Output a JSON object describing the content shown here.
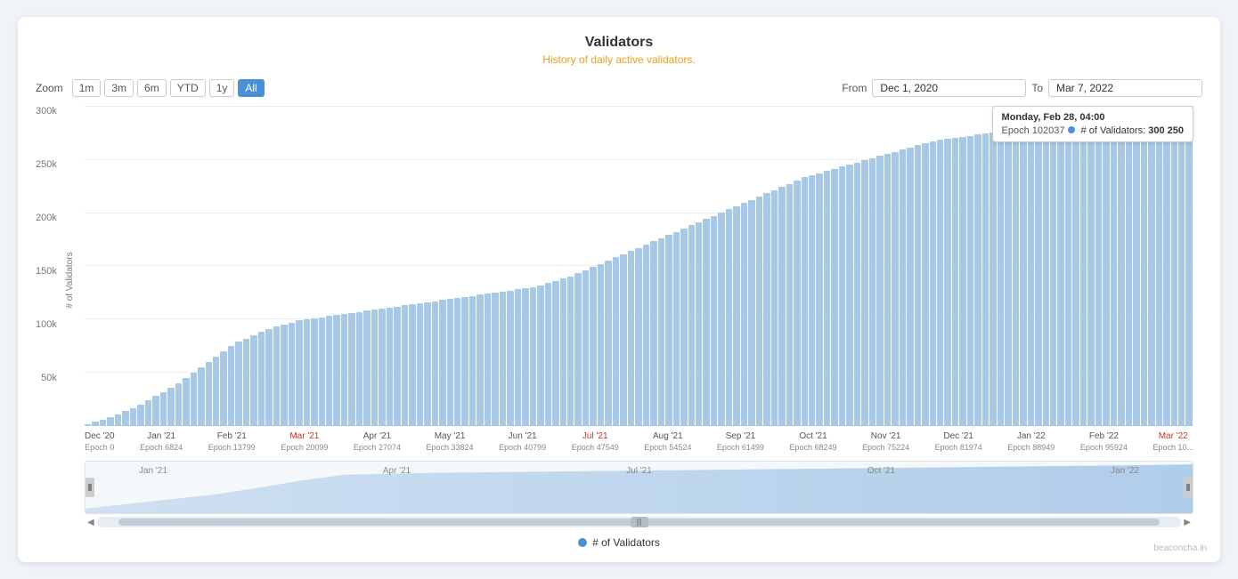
{
  "title": "Validators",
  "subtitle": "History of daily active validators.",
  "zoom": {
    "label": "Zoom",
    "options": [
      "1m",
      "3m",
      "6m",
      "YTD",
      "1y",
      "All"
    ],
    "active": "All"
  },
  "dateRange": {
    "from_label": "From",
    "from_value": "Dec 1, 2020",
    "to_label": "To",
    "to_value": "Mar 7, 2022"
  },
  "tooltip": {
    "date": "Monday, Feb 28, 04:00",
    "epoch_label": "Epoch 102037",
    "validators_label": "# of Validators:",
    "validators_value": "300 250"
  },
  "yAxis": {
    "title": "# of Validators",
    "labels": [
      "300k",
      "250k",
      "200k",
      "150k",
      "100k",
      "50k",
      ""
    ]
  },
  "xAxis": {
    "labels": [
      {
        "date": "Dec '20",
        "epoch": "Epoch 0",
        "red": false
      },
      {
        "date": "Jan '21",
        "epoch": "Epoch 6824",
        "red": false
      },
      {
        "date": "Feb '21",
        "epoch": "Epoch 13799",
        "red": false
      },
      {
        "date": "Mar '21",
        "epoch": "Epoch 20099",
        "red": true
      },
      {
        "date": "Apr '21",
        "epoch": "Epoch 27074",
        "red": false
      },
      {
        "date": "May '21",
        "epoch": "Epoch 33824",
        "red": false
      },
      {
        "date": "Jun '21",
        "epoch": "Epoch 40799",
        "red": false
      },
      {
        "date": "Jul '21",
        "epoch": "Epoch 47549",
        "red": true
      },
      {
        "date": "Aug '21",
        "epoch": "Epoch 54524",
        "red": false
      },
      {
        "date": "Sep '21",
        "epoch": "Epoch 61499",
        "red": false
      },
      {
        "date": "Oct '21",
        "epoch": "Epoch 68249",
        "red": false
      },
      {
        "date": "Nov '21",
        "epoch": "Epoch 75224",
        "red": false
      },
      {
        "date": "Dec '21",
        "epoch": "Epoch 81974",
        "red": false
      },
      {
        "date": "Jan '22",
        "epoch": "Epoch 88949",
        "red": false
      },
      {
        "date": "Feb '22",
        "epoch": "Epoch 95924",
        "red": false
      },
      {
        "date": "Mar '22",
        "epoch": "Epoch 10...",
        "red": true
      }
    ]
  },
  "navigator": {
    "labels": [
      "Jan '21",
      "Apr '21",
      "Jul '21",
      "Oct '21",
      "Jan '22"
    ]
  },
  "legend": {
    "label": "# of Validators"
  },
  "watermark": "beaconcha.in",
  "bars": [
    2,
    4,
    6,
    8,
    11,
    14,
    17,
    20,
    24,
    28,
    32,
    36,
    40,
    45,
    50,
    55,
    60,
    65,
    70,
    75,
    79,
    82,
    85,
    88,
    91,
    93,
    95,
    97,
    99,
    100,
    101,
    102,
    103,
    104,
    105,
    106,
    107,
    108,
    109,
    110,
    111,
    112,
    113,
    114,
    115,
    116,
    117,
    118,
    119,
    120,
    121,
    122,
    123,
    124,
    125,
    126,
    127,
    128,
    129,
    130,
    132,
    134,
    136,
    138,
    140,
    143,
    146,
    149,
    152,
    155,
    158,
    161,
    164,
    167,
    170,
    173,
    176,
    179,
    182,
    185,
    188,
    191,
    194,
    197,
    200,
    203,
    206,
    209,
    212,
    215,
    218,
    221,
    224,
    227,
    230,
    233,
    235,
    237,
    239,
    241,
    243,
    245,
    247,
    249,
    251,
    253,
    255,
    257,
    259,
    261,
    263,
    265,
    267,
    268,
    269,
    270,
    271,
    272,
    273,
    274,
    275,
    276,
    277,
    278,
    279,
    280,
    281,
    282,
    283,
    284,
    285,
    286,
    287,
    288,
    289,
    290,
    291,
    292,
    293,
    294,
    295,
    296,
    297,
    298,
    299,
    300,
    300
  ],
  "maxValue": 300
}
